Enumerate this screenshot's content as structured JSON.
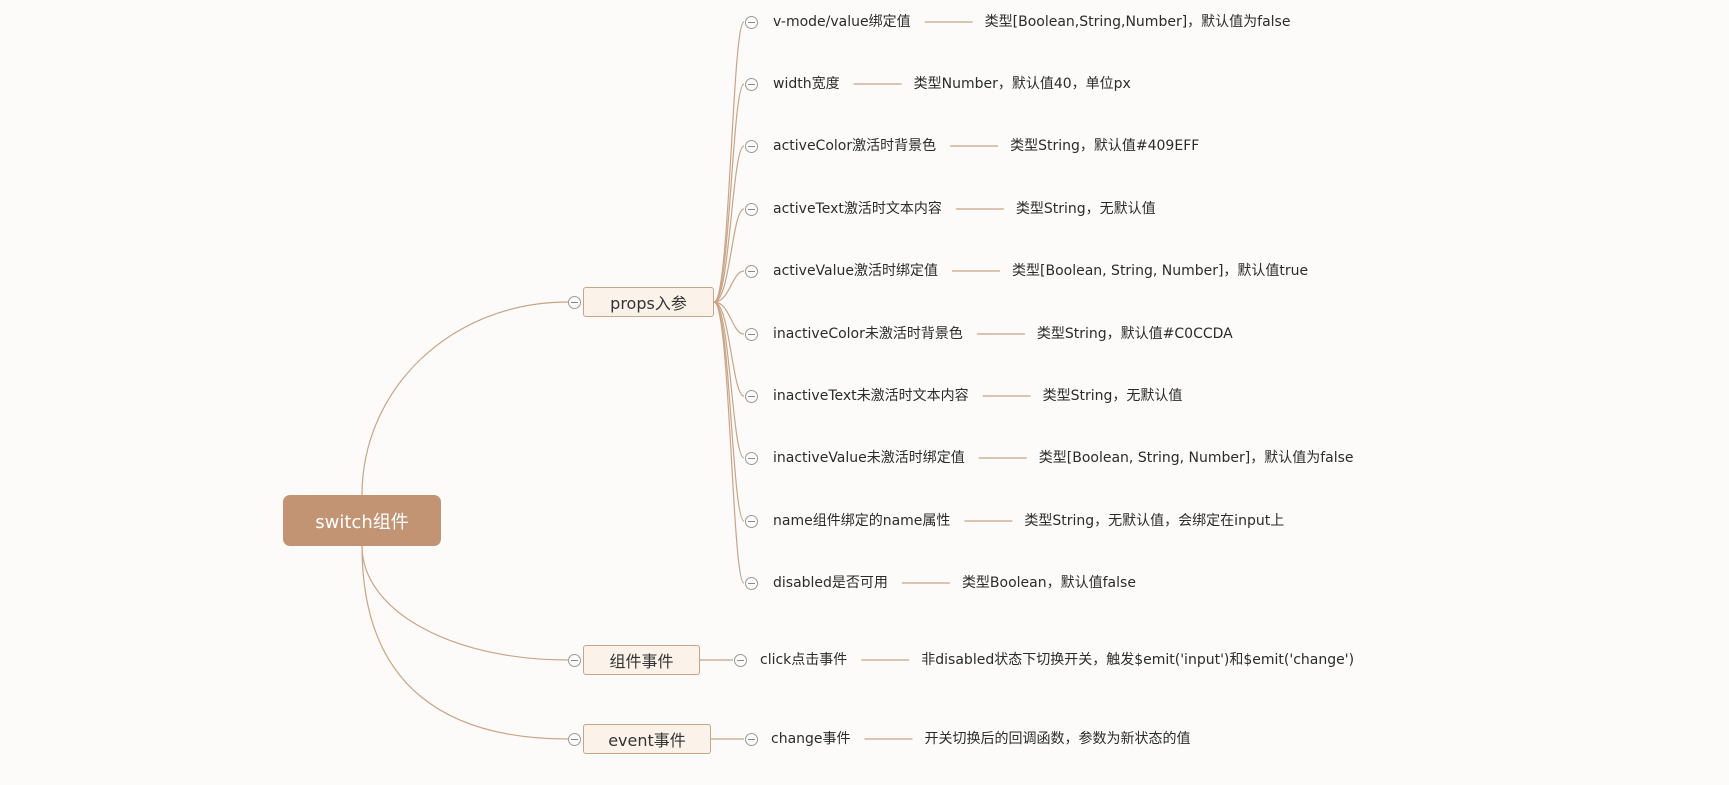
{
  "root": {
    "label": "switch组件"
  },
  "branches": [
    {
      "label": "props入参",
      "items": [
        {
          "label": "v-mode/value绑定值",
          "desc": "类型[Boolean,String,Number]，默认值为false"
        },
        {
          "label": "width宽度",
          "desc": "类型Number，默认值40，单位px"
        },
        {
          "label": "activeColor激活时背景色",
          "desc": "类型String，默认值#409EFF"
        },
        {
          "label": "activeText激活时文本内容",
          "desc": "类型String，无默认值"
        },
        {
          "label": "activeValue激活时绑定值",
          "desc": "类型[Boolean, String, Number]，默认值true"
        },
        {
          "label": "inactiveColor未激活时背景色",
          "desc": "类型String，默认值#C0CCDA"
        },
        {
          "label": "inactiveText未激活时文本内容",
          "desc": "类型String，无默认值"
        },
        {
          "label": "inactiveValue未激活时绑定值",
          "desc": "类型[Boolean, String, Number]，默认值为false"
        },
        {
          "label": "name组件绑定的name属性",
          "desc": "类型String，无默认值，会绑定在input上"
        },
        {
          "label": "disabled是否可用",
          "desc": "类型Boolean，默认值false"
        }
      ]
    },
    {
      "label": "组件事件",
      "items": [
        {
          "label": "click点击事件",
          "desc": "非disabled状态下切换开关，触发$emit('input')和$emit('change')"
        }
      ]
    },
    {
      "label": "event事件",
      "items": [
        {
          "label": "change事件",
          "desc": "开关切换后的回调函数，参数为新状态的值"
        }
      ]
    }
  ],
  "colors": {
    "line": "#c9a487",
    "root_fill": "#c29474",
    "branch_fill": "#fbf2ea"
  }
}
